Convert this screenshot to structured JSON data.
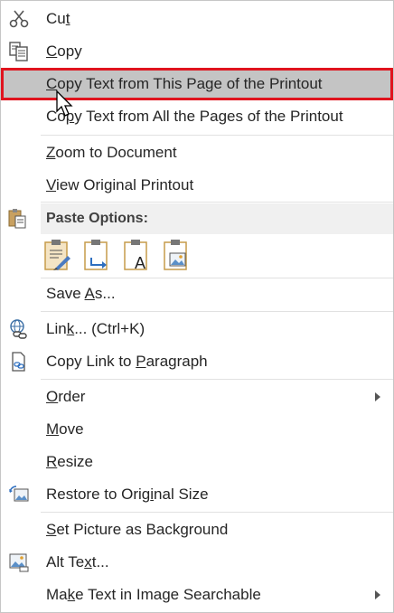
{
  "menu": {
    "cut": {
      "pre": "Cu",
      "u": "t",
      "post": ""
    },
    "copy": {
      "pre": "",
      "u": "C",
      "post": "opy"
    },
    "copy_this_page": {
      "pre": "",
      "u": "C",
      "post": "opy Text from This Page of the Printout"
    },
    "copy_all_pages": {
      "pre": "Co",
      "u": "p",
      "post": "y Text from All the Pages of the Printout"
    },
    "zoom": {
      "pre": "",
      "u": "Z",
      "post": "oom to Document"
    },
    "view_original": {
      "pre": "",
      "u": "V",
      "post": "iew Original Printout"
    },
    "paste_options": "Paste Options:",
    "save_as": {
      "pre": "Save ",
      "u": "A",
      "post": "s..."
    },
    "link": {
      "pre": "Lin",
      "u": "k",
      "post": "...  (Ctrl+K)"
    },
    "copy_link": {
      "pre": "Copy Link to ",
      "u": "P",
      "post": "aragraph"
    },
    "order": {
      "pre": "",
      "u": "O",
      "post": "rder"
    },
    "move": {
      "pre": "",
      "u": "M",
      "post": "ove"
    },
    "resize": {
      "pre": "",
      "u": "R",
      "post": "esize"
    },
    "restore": {
      "pre": "Restore to Orig",
      "u": "i",
      "post": "nal Size"
    },
    "set_background": {
      "pre": "",
      "u": "S",
      "post": "et Picture as Background"
    },
    "alt_text": {
      "pre": "Alt Te",
      "u": "x",
      "post": "t..."
    },
    "make_searchable": {
      "pre": "Ma",
      "u": "k",
      "post": "e Text in Image Searchable"
    }
  },
  "paste_buttons": [
    "keep-source-formatting-icon",
    "merge-formatting-icon",
    "keep-text-only-icon",
    "paste-as-picture-icon"
  ],
  "colors": {
    "highlight_bg": "#c4c4c4",
    "highlight_border": "#e0141e",
    "header_bg": "#f0f0f0"
  }
}
